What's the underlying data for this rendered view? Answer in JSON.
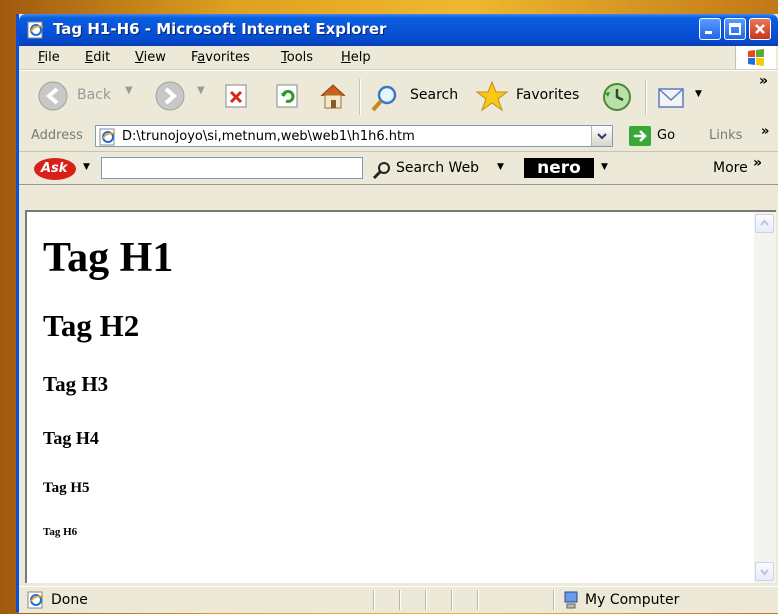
{
  "window": {
    "title": "Tag H1-H6 - Microsoft Internet Explorer"
  },
  "menu": {
    "items": [
      {
        "label": "File",
        "underline": "F",
        "rest": "ile"
      },
      {
        "label": "Edit",
        "underline": "E",
        "rest": "dit"
      },
      {
        "label": "View",
        "underline": "V",
        "rest": "iew"
      },
      {
        "label": "Favorites",
        "underline": "a",
        "pre": "F",
        "rest": "vorites"
      },
      {
        "label": "Tools",
        "underline": "T",
        "rest": "ools"
      },
      {
        "label": "Help",
        "underline": "H",
        "rest": "elp"
      }
    ]
  },
  "toolbar": {
    "back_label": "Back",
    "search_label": "Search",
    "favorites_label": "Favorites",
    "chevron": "»"
  },
  "address": {
    "label": "Address",
    "url": "D:\\trunojoyo\\si,metnum,web\\web1\\h1h6.htm",
    "go_label": "Go",
    "links_label": "Links",
    "chevron": "»"
  },
  "askbar": {
    "logo_text": "Ask",
    "search_web_label": "Search Web",
    "nero_label": "nero",
    "more_label": "More",
    "more_chevron": "»"
  },
  "content": {
    "h1": "Tag H1",
    "h2": "Tag H2",
    "h3": "Tag H3",
    "h4": "Tag H4",
    "h5": "Tag H5",
    "h6": "Tag H6"
  },
  "status": {
    "left_text": "Done",
    "zone_text": "My Computer"
  },
  "colors": {
    "titlebar": "#0753d8",
    "chrome": "#ece9d8",
    "desktop": "#e0a020"
  }
}
